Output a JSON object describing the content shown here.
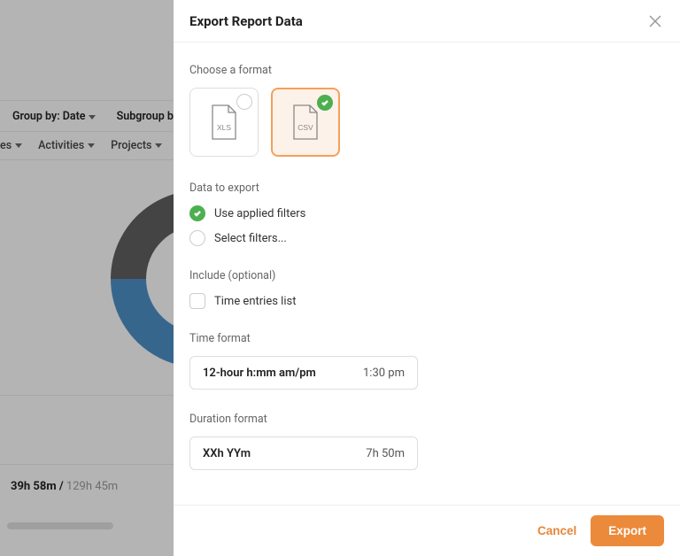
{
  "background": {
    "toolbar1": {
      "group_by_label": "Group by: Date",
      "subgroup_label": "Subgroup by"
    },
    "toolbar2": {
      "item_partial": "es",
      "activities": "Activities",
      "projects": "Projects"
    },
    "stats": {
      "bold": "39h 58m /",
      "light": " 129h 45m"
    }
  },
  "modal": {
    "title": "Export Report Data",
    "choose_format_label": "Choose a format",
    "formats": {
      "xls": {
        "label": "XLS",
        "selected": false
      },
      "csv": {
        "label": "CSV",
        "selected": true
      }
    },
    "data_to_export_label": "Data to export",
    "data_options": {
      "use_applied": "Use applied filters",
      "select_filters": "Select filters..."
    },
    "include_label": "Include (optional)",
    "include_options": {
      "time_entries": "Time entries list"
    },
    "time_format": {
      "label": "Time format",
      "value": "12-hour h:mm am/pm",
      "example": "1:30 pm"
    },
    "duration_format": {
      "label": "Duration format",
      "value": "XXh YYm",
      "example": "7h 50m"
    },
    "footer": {
      "cancel": "Cancel",
      "export": "Export"
    }
  }
}
